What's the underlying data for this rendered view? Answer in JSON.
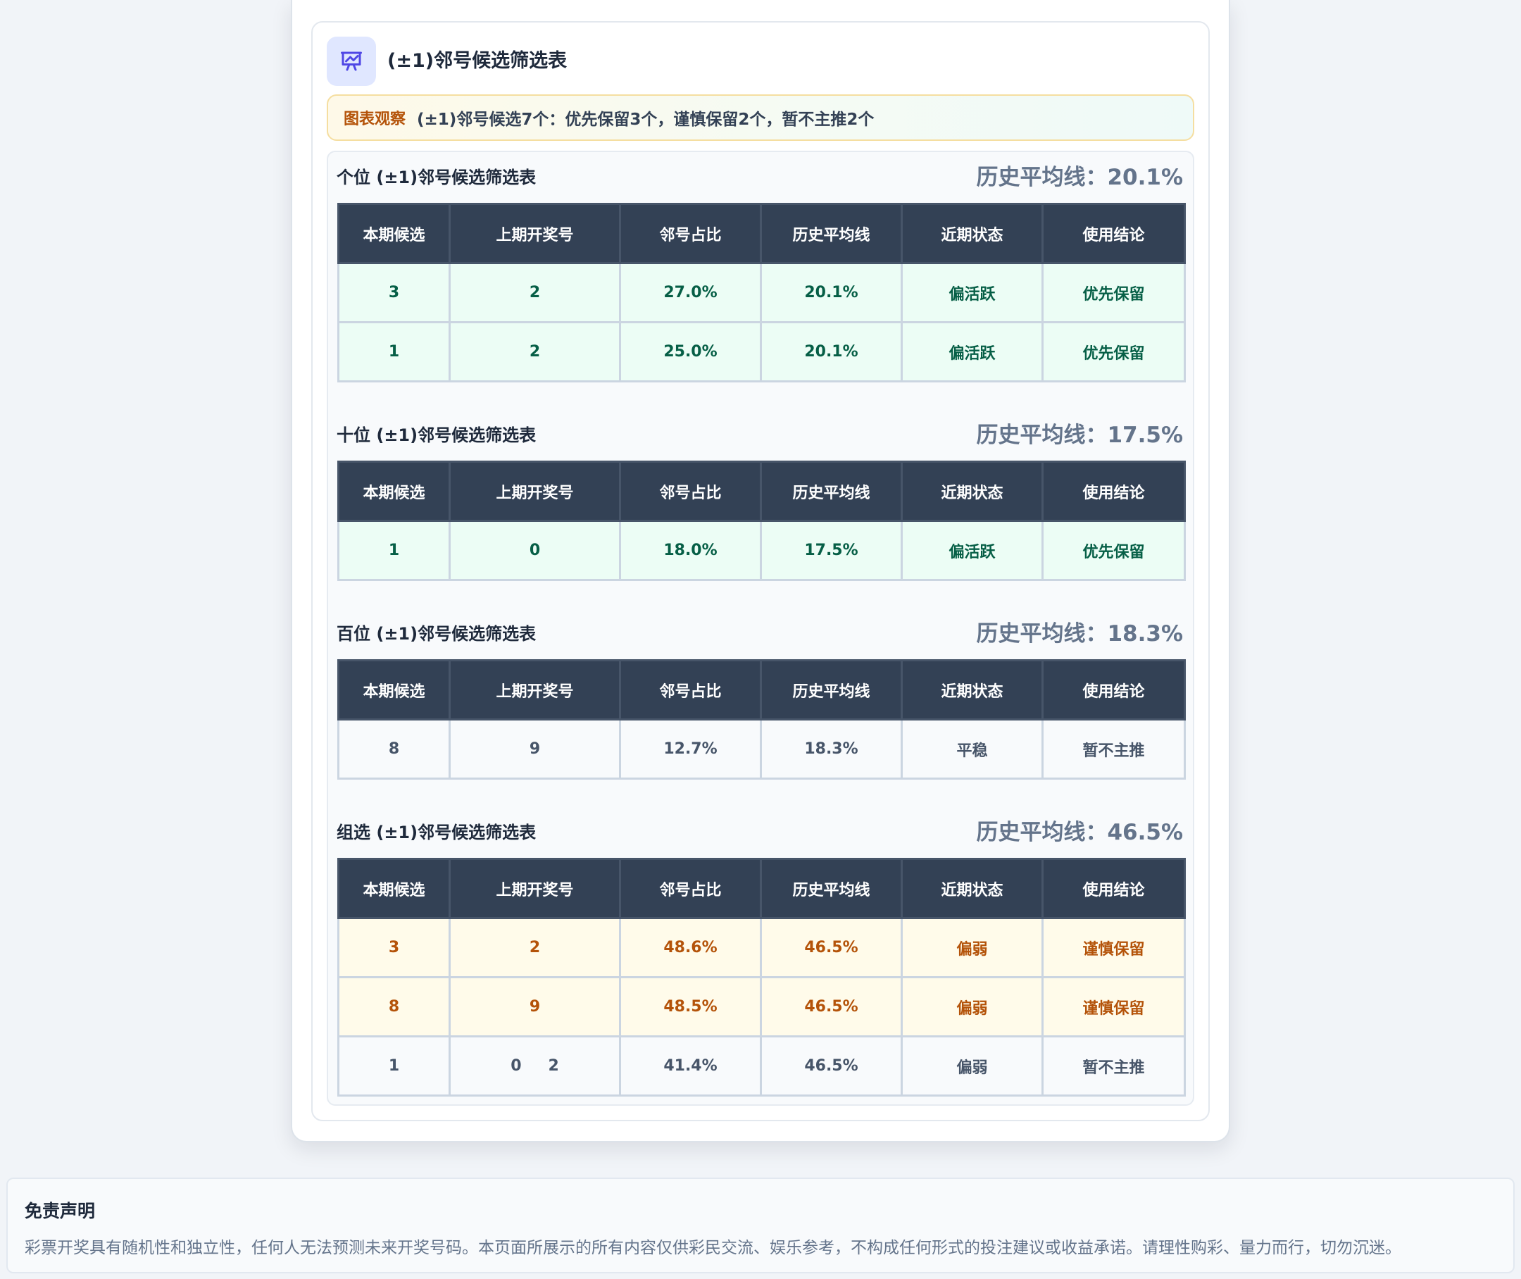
{
  "header": {
    "title": "(±1)邻号候选筛选表",
    "icon": "presentation-chart-icon"
  },
  "observation": {
    "tag": "图表观察",
    "text": "(±1)邻号候选7个：优先保留3个，谨慎保留2个，暂不主推2个"
  },
  "columns": [
    "本期候选",
    "上期开奖号",
    "邻号占比",
    "历史平均线",
    "近期状态",
    "使用结论"
  ],
  "sections": [
    {
      "title": "个位 (±1)邻号候选筛选表",
      "avg_label": "历史平均线：20.1%",
      "rows": [
        {
          "candidate": "3",
          "prev": [
            "2"
          ],
          "ratio": "27.0%",
          "avg": "20.1%",
          "status": "偏活跃",
          "conclusion": "优先保留",
          "tone": "green"
        },
        {
          "candidate": "1",
          "prev": [
            "2"
          ],
          "ratio": "25.0%",
          "avg": "20.1%",
          "status": "偏活跃",
          "conclusion": "优先保留",
          "tone": "green"
        }
      ]
    },
    {
      "title": "十位 (±1)邻号候选筛选表",
      "avg_label": "历史平均线：17.5%",
      "rows": [
        {
          "candidate": "1",
          "prev": [
            "0"
          ],
          "ratio": "18.0%",
          "avg": "17.5%",
          "status": "偏活跃",
          "conclusion": "优先保留",
          "tone": "green"
        }
      ]
    },
    {
      "title": "百位 (±1)邻号候选筛选表",
      "avg_label": "历史平均线：18.3%",
      "rows": [
        {
          "candidate": "8",
          "prev": [
            "9"
          ],
          "ratio": "12.7%",
          "avg": "18.3%",
          "status": "平稳",
          "conclusion": "暂不主推",
          "tone": "plain"
        }
      ]
    },
    {
      "title": "组选 (±1)邻号候选筛选表",
      "avg_label": "历史平均线：46.5%",
      "rows": [
        {
          "candidate": "3",
          "prev": [
            "2"
          ],
          "ratio": "48.6%",
          "avg": "46.5%",
          "status": "偏弱",
          "conclusion": "谨慎保留",
          "tone": "yellow"
        },
        {
          "candidate": "8",
          "prev": [
            "9"
          ],
          "ratio": "48.5%",
          "avg": "46.5%",
          "status": "偏弱",
          "conclusion": "谨慎保留",
          "tone": "yellow"
        },
        {
          "candidate": "1",
          "prev": [
            "0",
            "2"
          ],
          "ratio": "41.4%",
          "avg": "46.5%",
          "status": "偏弱",
          "conclusion": "暂不主推",
          "tone": "plain"
        }
      ]
    }
  ],
  "disclaimer": {
    "title": "免责声明",
    "text": "彩票开奖具有随机性和独立性，任何人无法预测未来开奖号码。本页面所展示的所有内容仅供彩民交流、娱乐参考，不构成任何形式的投注建议或收益承诺。请理性购彩、量力而行，切勿沉迷。"
  },
  "colors": {
    "header_bg": "#334155",
    "green_row_bg": "#ecfdf5",
    "green_text": "#065f46",
    "yellow_row_bg": "#fffbea",
    "yellow_text": "#b45309",
    "icon_bg": "#e0e7ff",
    "icon_color": "#4f46e5"
  }
}
